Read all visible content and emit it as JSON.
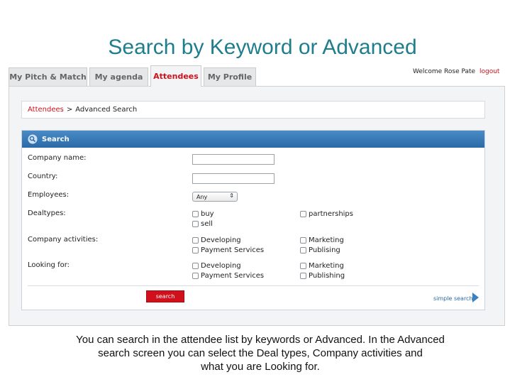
{
  "slide": {
    "title": "Search by Keyword or Advanced",
    "caption_line1": "You can search in the attendee list by keywords or Advanced. In the Advanced",
    "caption_line2": "search screen you can select the Deal types, Company activities and",
    "caption_line3": "what you are Looking for."
  },
  "tabs": [
    {
      "label": "My Pitch & Match",
      "active": false
    },
    {
      "label": "My agenda",
      "active": false
    },
    {
      "label": "Attendees",
      "active": true
    },
    {
      "label": "My Profile",
      "active": false
    }
  ],
  "user": {
    "welcome": "Welcome Rose Pate",
    "logout": "logout"
  },
  "breadcrumb": {
    "link": "Attendees",
    "separator": ">",
    "current": "Advanced Search"
  },
  "search": {
    "header": "Search",
    "header_icon": "magnifier-icon",
    "fields": {
      "company_name": {
        "label": "Company name:",
        "value": ""
      },
      "country": {
        "label": "Country:",
        "value": ""
      },
      "employees": {
        "label": "Employees:",
        "selected": "Any"
      }
    },
    "dealtypes": {
      "label": "Dealtypes:",
      "options": [
        "buy",
        "partnerships",
        "sell"
      ]
    },
    "company_activities": {
      "label": "Company activities:",
      "options": [
        "Developing",
        "Marketing",
        "Payment Services",
        "Publising"
      ]
    },
    "looking_for": {
      "label": "Looking for:",
      "options": [
        "Developing",
        "Marketing",
        "Payment Services",
        "Publishing"
      ]
    },
    "search_button": "search",
    "simple_search": "simple search"
  },
  "colors": {
    "title": "#1f7d8c",
    "accent_red": "#d0101b",
    "header_blue": "#2b6aa7"
  }
}
